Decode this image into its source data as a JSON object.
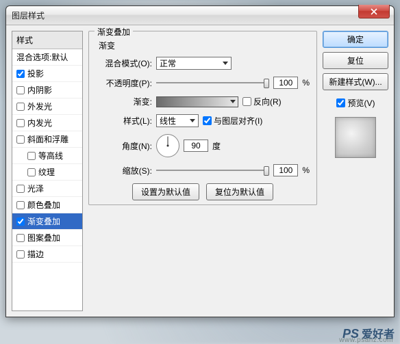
{
  "dialog": {
    "title": "图层样式",
    "leftcol": {
      "header": "样式",
      "blendOptions": "混合选项:默认",
      "items": [
        {
          "label": "投影",
          "checked": true,
          "selected": false,
          "indent": false
        },
        {
          "label": "内阴影",
          "checked": false,
          "selected": false,
          "indent": false
        },
        {
          "label": "外发光",
          "checked": false,
          "selected": false,
          "indent": false
        },
        {
          "label": "内发光",
          "checked": false,
          "selected": false,
          "indent": false
        },
        {
          "label": "斜面和浮雕",
          "checked": false,
          "selected": false,
          "indent": false
        },
        {
          "label": "等高线",
          "checked": false,
          "selected": false,
          "indent": true
        },
        {
          "label": "纹理",
          "checked": false,
          "selected": false,
          "indent": true
        },
        {
          "label": "光泽",
          "checked": false,
          "selected": false,
          "indent": false
        },
        {
          "label": "颜色叠加",
          "checked": false,
          "selected": false,
          "indent": false
        },
        {
          "label": "渐变叠加",
          "checked": true,
          "selected": true,
          "indent": false
        },
        {
          "label": "图案叠加",
          "checked": false,
          "selected": false,
          "indent": false
        },
        {
          "label": "描边",
          "checked": false,
          "selected": false,
          "indent": false
        }
      ]
    },
    "panel": {
      "legend": "渐变叠加",
      "sublabel": "渐变",
      "blendMode": {
        "label": "混合模式(O):",
        "value": "正常"
      },
      "opacity": {
        "label": "不透明度(P):",
        "value": "100",
        "unit": "%"
      },
      "gradient": {
        "label": "渐变:",
        "reverse": "反向(R)",
        "reverseChecked": false
      },
      "style": {
        "label": "样式(L):",
        "value": "线性",
        "align": "与图层对齐(I)",
        "alignChecked": true
      },
      "angle": {
        "label": "角度(N):",
        "value": "90",
        "unit": "度"
      },
      "scale": {
        "label": "缩放(S):",
        "value": "100",
        "unit": "%"
      },
      "buttons": {
        "default": "设置为默认值",
        "reset": "复位为默认值"
      }
    },
    "right": {
      "ok": "确定",
      "cancel": "复位",
      "newStyle": "新建样式(W)...",
      "preview": "预览(V)",
      "previewChecked": true
    }
  },
  "watermark": {
    "brand": "PS",
    "cn": "爱好者",
    "url": "www.psahz.com"
  }
}
